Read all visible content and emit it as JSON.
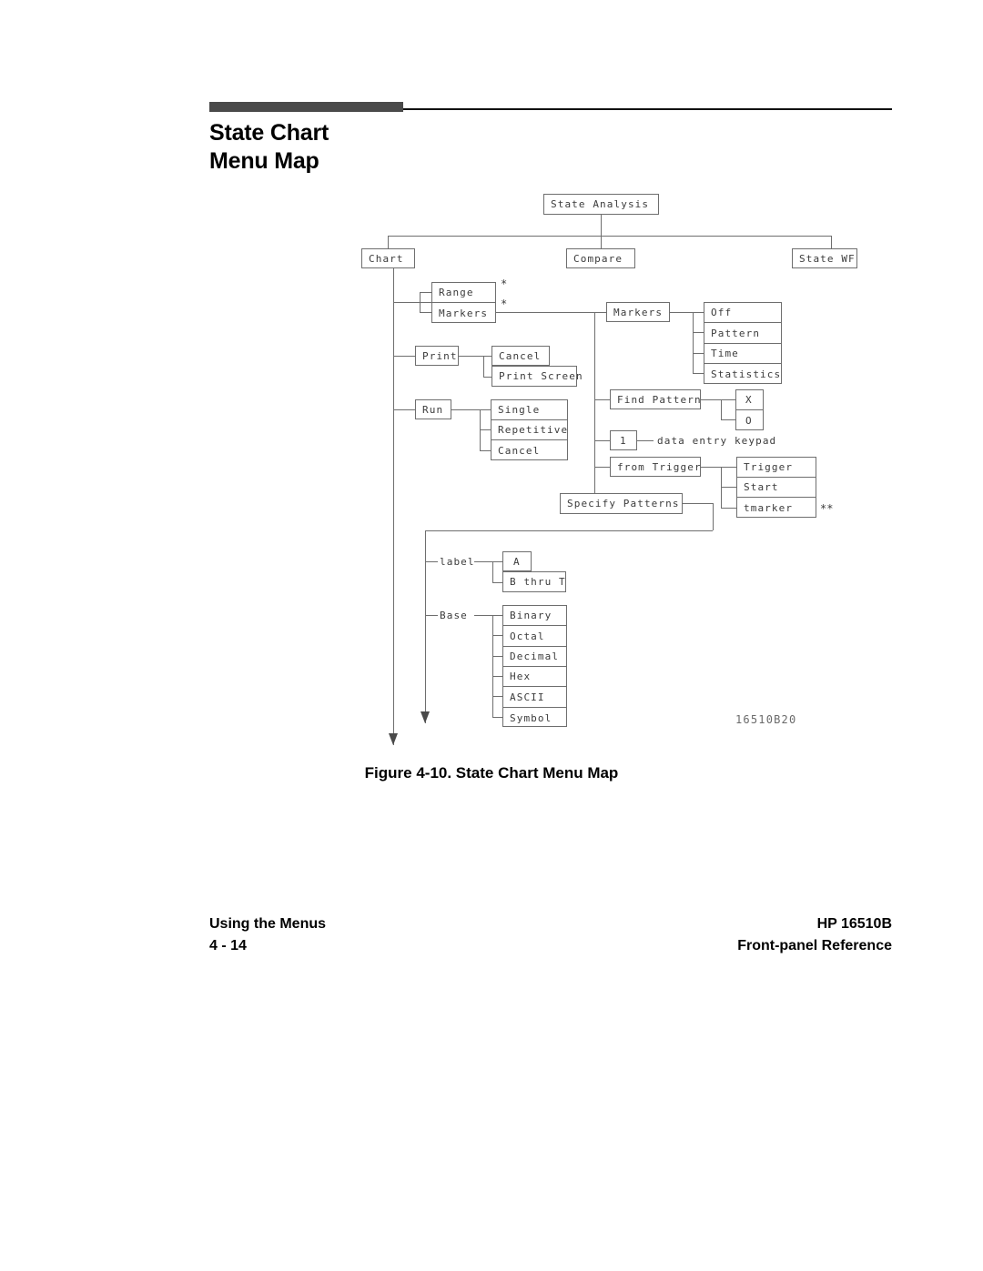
{
  "header": {
    "title_line1": "State Chart",
    "title_line2": "Menu Map"
  },
  "figure": {
    "caption": "Figure 4-10. State Chart Menu Map",
    "drawing_id": "16510B20",
    "footnote_single": "*",
    "footnote_double": "**"
  },
  "nodes": {
    "root": "State Analysis",
    "chart": "Chart",
    "compare": "Compare",
    "state_wf": "State WF",
    "range": "Range",
    "markers_left": "Markers",
    "print": "Print",
    "print_cancel": "Cancel",
    "print_screen": "Print Screen",
    "run": "Run",
    "run_single": "Single",
    "run_repetitive": "Repetitive",
    "run_cancel": "Cancel",
    "markers_right": "Markers",
    "markers_off": "Off",
    "markers_pattern": "Pattern",
    "markers_time": "Time",
    "markers_statistics": "Statistics",
    "find_pattern": "Find Pattern",
    "find_x": "X",
    "find_o": "O",
    "occurrence": "1",
    "keypad": "data entry keypad",
    "from_trigger": "from Trigger",
    "trigger": "Trigger",
    "start": "Start",
    "tmarker": "tmarker",
    "specify_patterns": "Specify Patterns",
    "label": "label",
    "label_a": "A",
    "label_b_thru_t": "B thru T",
    "base": "Base",
    "base_binary": "Binary",
    "base_octal": "Octal",
    "base_decimal": "Decimal",
    "base_hex": "Hex",
    "base_ascii": "ASCII",
    "base_symbol": "Symbol"
  },
  "footer": {
    "left_line1": "Using the Menus",
    "left_line2": "4 - 14",
    "right_line1": "HP 16510B",
    "right_line2": "Front-panel Reference"
  }
}
